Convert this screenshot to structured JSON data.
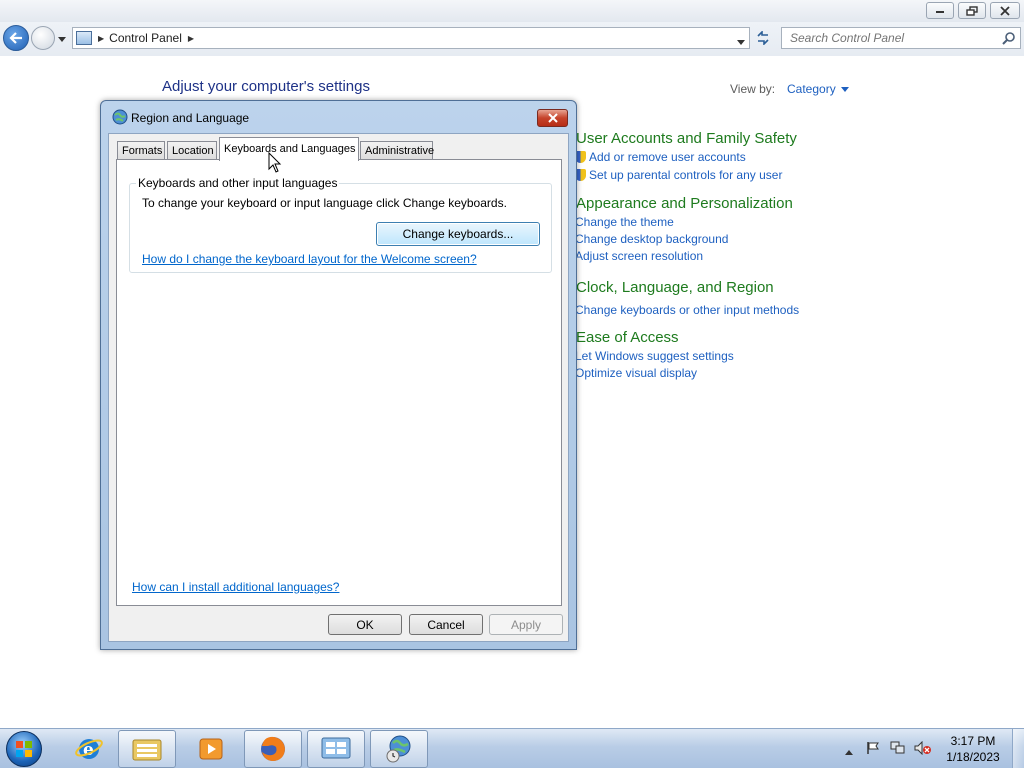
{
  "control_panel": {
    "breadcrumb": "Control Panel",
    "search_placeholder": "Search Control Panel",
    "heading": "Adjust your computer's settings",
    "view_by_label": "View by:",
    "view_by_value": "Category",
    "categories": [
      {
        "title": "User Accounts and Family Safety",
        "links": [
          "Add or remove user accounts",
          "Set up parental controls for any user"
        ]
      },
      {
        "title": "Appearance and Personalization",
        "links": [
          "Change the theme",
          "Change desktop background",
          "Adjust screen resolution"
        ]
      },
      {
        "title": "Clock, Language, and Region",
        "links": [
          "Change keyboards or other input methods"
        ]
      },
      {
        "title": "Ease of Access",
        "links": [
          "Let Windows suggest settings",
          "Optimize visual display"
        ]
      }
    ]
  },
  "dialog": {
    "title": "Region and Language",
    "tabs": [
      "Formats",
      "Location",
      "Keyboards and Languages",
      "Administrative"
    ],
    "selected_tab": "Keyboards and Languages",
    "group_label": "Keyboards and other input languages",
    "group_description": "To change your keyboard or input language click Change keyboards.",
    "change_keyboards_button": "Change keyboards...",
    "welcome_link": "How do I change the keyboard layout for the Welcome screen?",
    "install_link": "How can I install additional languages?",
    "ok_button": "OK",
    "cancel_button": "Cancel",
    "apply_button": "Apply"
  },
  "taskbar": {
    "time": "3:17 PM",
    "date": "1/18/2023",
    "pinned_icons": [
      "start-orb",
      "internet-explorer-icon",
      "file-explorer-icon",
      "media-player-icon",
      "firefox-icon",
      "control-panel-icon",
      "region-language-icon"
    ]
  },
  "colors": {
    "category_title": "#1e7b1e",
    "link": "#1e60c0",
    "heading": "#1e3287",
    "dialog_frame": "#bcd3ec"
  }
}
